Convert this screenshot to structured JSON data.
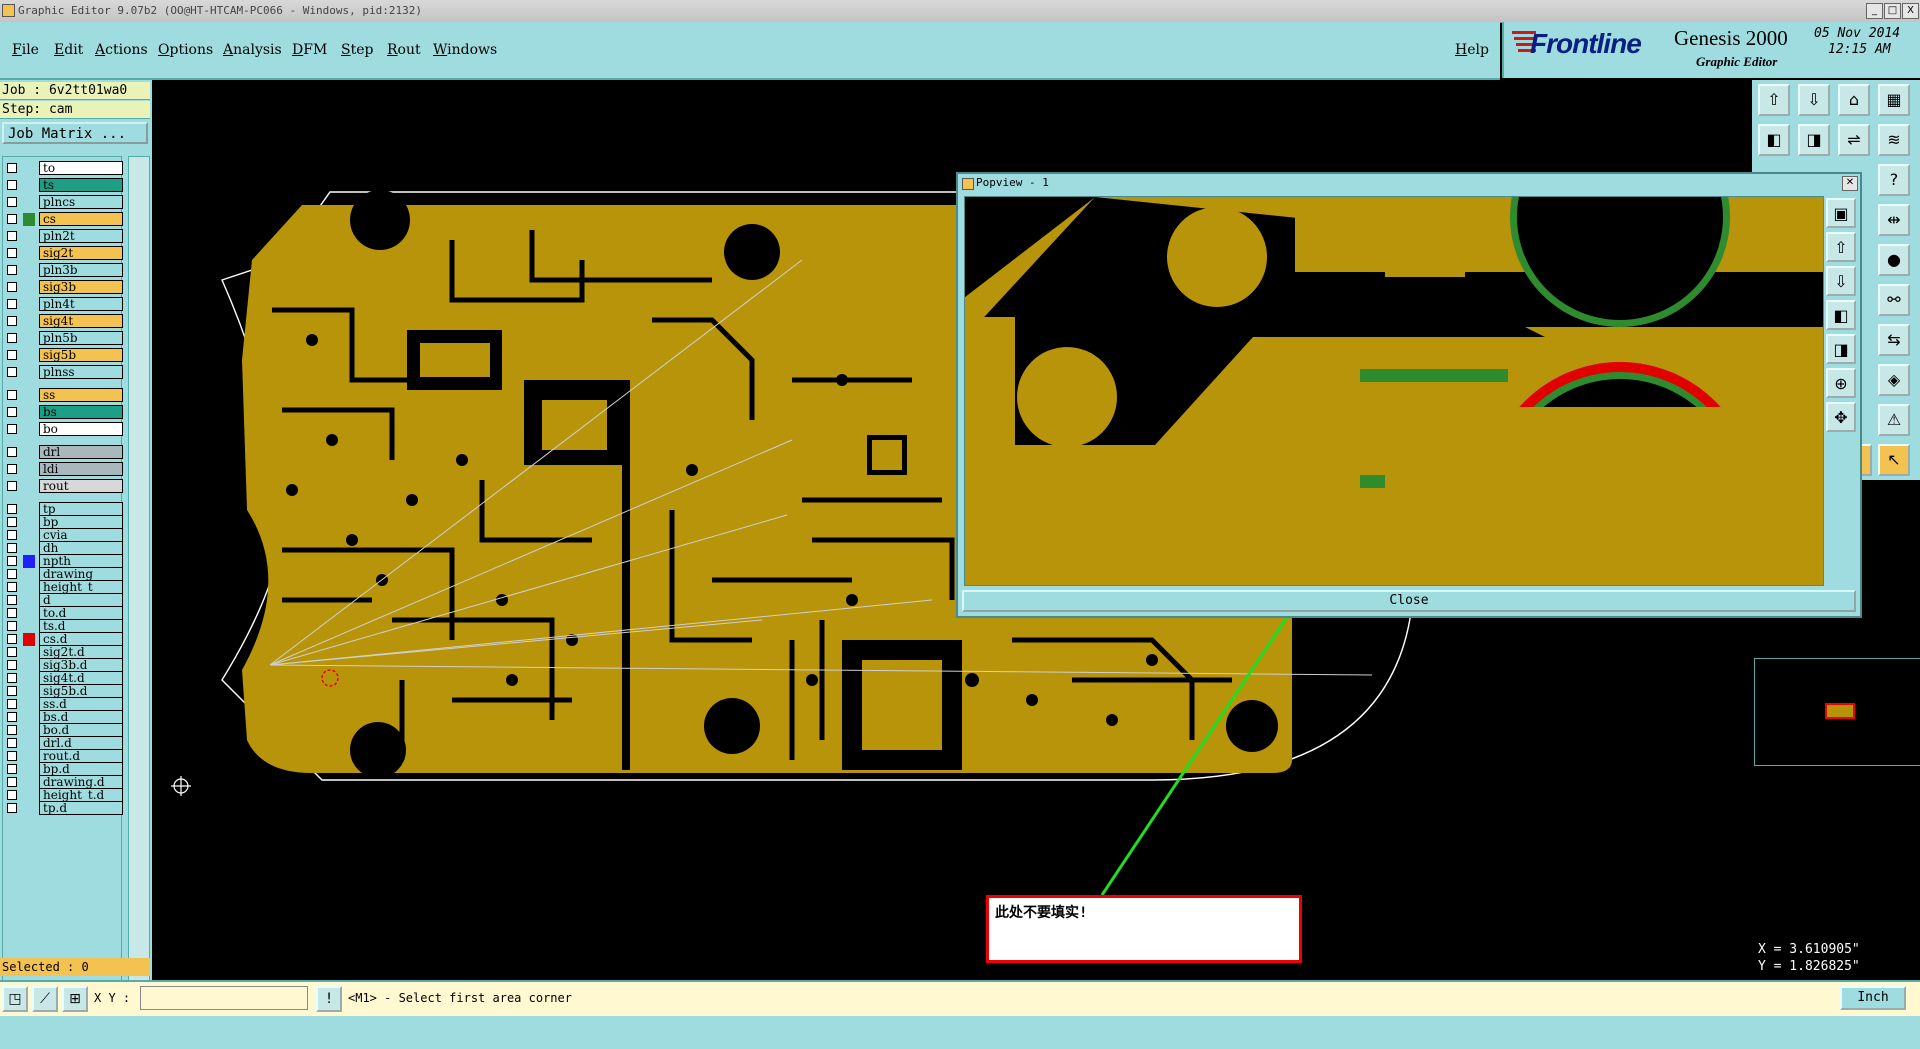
{
  "window": {
    "title": "Graphic Editor 9.07b2 (OO@HT-HTCAM-PC066 - Windows, pid:2132)",
    "minimize": "_",
    "maximize": "□",
    "close": "X"
  },
  "menu": {
    "items": [
      "File",
      "Edit",
      "Actions",
      "Options",
      "Analysis",
      "DFM",
      "Step",
      "Rout",
      "Windows"
    ],
    "help": "Help"
  },
  "brand": {
    "logo": "Frontline",
    "product": "Genesis 2000",
    "subtitle": "Graphic Editor",
    "date": "05 Nov 2014",
    "time": "12:15 AM"
  },
  "job": {
    "job_line": "Job : 6v2tt01wa0",
    "step_line": "Step: cam",
    "matrix_button": "Job Matrix ..."
  },
  "layers": [
    {
      "name": "to",
      "color": "#ffffff"
    },
    {
      "name": "ts",
      "color": "#1f9e86"
    },
    {
      "name": "plncs",
      "color": "#9fdcdf"
    },
    {
      "name": "cs",
      "color": "#f4c250",
      "swatch": "#2e8b2e"
    },
    {
      "name": "pln2t",
      "color": "#9fdcdf"
    },
    {
      "name": "sig2t",
      "color": "#f4c250"
    },
    {
      "name": "pln3b",
      "color": "#9fdcdf"
    },
    {
      "name": "sig3b",
      "color": "#f4c250"
    },
    {
      "name": "pln4t",
      "color": "#9fdcdf"
    },
    {
      "name": "sig4t",
      "color": "#f4c250"
    },
    {
      "name": "pln5b",
      "color": "#9fdcdf"
    },
    {
      "name": "sig5b",
      "color": "#f4c250"
    },
    {
      "name": "plnss",
      "color": "#9fdcdf"
    },
    {
      "name": "ss",
      "color": "#f4c250"
    },
    {
      "name": "bs",
      "color": "#1f9e86"
    },
    {
      "name": "bo",
      "color": "#ffffff"
    },
    {
      "name": "drl",
      "color": "#a8b8bc"
    },
    {
      "name": "ldi",
      "color": "#a8b8bc"
    },
    {
      "name": "rout",
      "color": "#d8d8d8"
    },
    {
      "name": "tp",
      "color": "#9fdcdf"
    },
    {
      "name": "bp",
      "color": "#9fdcdf"
    },
    {
      "name": "cvia",
      "color": "#9fdcdf"
    },
    {
      "name": "dh",
      "color": "#9fdcdf"
    },
    {
      "name": "npth",
      "color": "#9fdcdf",
      "swatch": "#1f1fff"
    },
    {
      "name": "drawing",
      "color": "#9fdcdf"
    },
    {
      "name": "height_t",
      "color": "#9fdcdf"
    },
    {
      "name": "d",
      "color": "#9fdcdf"
    },
    {
      "name": "to.d",
      "color": "#9fdcdf"
    },
    {
      "name": "ts.d",
      "color": "#9fdcdf"
    },
    {
      "name": "cs.d",
      "color": "#9fdcdf",
      "swatch": "#e00000"
    },
    {
      "name": "sig2t.d",
      "color": "#9fdcdf"
    },
    {
      "name": "sig3b.d",
      "color": "#9fdcdf"
    },
    {
      "name": "sig4t.d",
      "color": "#9fdcdf"
    },
    {
      "name": "sig5b.d",
      "color": "#9fdcdf"
    },
    {
      "name": "ss.d",
      "color": "#9fdcdf"
    },
    {
      "name": "bs.d",
      "color": "#9fdcdf"
    },
    {
      "name": "bo.d",
      "color": "#9fdcdf"
    },
    {
      "name": "drl.d",
      "color": "#9fdcdf"
    },
    {
      "name": "rout.d",
      "color": "#9fdcdf"
    },
    {
      "name": "bp.d",
      "color": "#9fdcdf"
    },
    {
      "name": "drawing.d",
      "color": "#9fdcdf"
    },
    {
      "name": "height_t.d",
      "color": "#9fdcdf"
    },
    {
      "name": "tp.d",
      "color": "#9fdcdf"
    }
  ],
  "selected": "Selected : 0",
  "popview": {
    "title": "Popview - 1",
    "close_button": "Close"
  },
  "annotation": {
    "text": "此处不要填实!"
  },
  "coords": {
    "x": "X = 3.610905\"",
    "y": "Y = 1.826825\""
  },
  "bottom": {
    "xy_label": "X Y :",
    "xy_value": "",
    "prompt": "<M1> - Select first area corner",
    "units": "Inch"
  },
  "colors": {
    "copper": "#b8940a",
    "panel": "#9fdcdf",
    "highlight": "#f4c250",
    "arrow": "#22dd22",
    "annotation_border": "#ee0000"
  }
}
